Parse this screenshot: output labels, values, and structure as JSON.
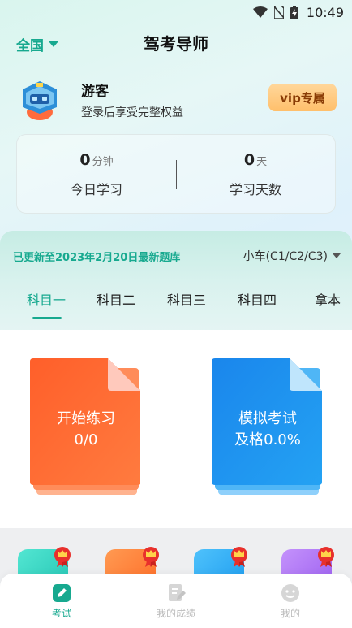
{
  "status_bar": {
    "time": "10:49"
  },
  "header": {
    "region": "全国",
    "title": "驾考导师"
  },
  "profile": {
    "name": "游客",
    "hint": "登录后享受完整权益",
    "vip_label": "vip专属"
  },
  "stats": {
    "today": {
      "value": "0",
      "unit": "分钟",
      "label": "今日学习"
    },
    "days": {
      "value": "0",
      "unit": "天",
      "label": "学习天数"
    }
  },
  "bank": {
    "update_text": "已更新至2023年2月20日最新题库",
    "car_type": "小车(C1/C2/C3)"
  },
  "tabs": [
    {
      "label": "科目一",
      "active": true
    },
    {
      "label": "科目二",
      "active": false
    },
    {
      "label": "科目三",
      "active": false
    },
    {
      "label": "科目四",
      "active": false
    },
    {
      "label": "拿本",
      "active": false
    }
  ],
  "cards": {
    "practice": {
      "title": "开始练习",
      "value": "0/0",
      "color": "#ff6a2e"
    },
    "exam": {
      "title": "模拟考试",
      "value": "及格0.0%",
      "color": "#1e90f0"
    }
  },
  "features": [
    {
      "icon": "feature-teal-icon",
      "color": "#2ad3c0"
    },
    {
      "icon": "feature-orange-icon",
      "color": "#ff7a30"
    },
    {
      "icon": "feature-blue-icon",
      "color": "#22a6f2"
    },
    {
      "icon": "feature-purple-icon",
      "color": "#a86cf0"
    }
  ],
  "bottom_nav": [
    {
      "label": "考试",
      "active": true,
      "icon": "pencil-icon"
    },
    {
      "label": "我的成绩",
      "active": false,
      "icon": "report-icon"
    },
    {
      "label": "我的",
      "active": false,
      "icon": "smile-icon"
    }
  ],
  "colors": {
    "accent": "#17a98f"
  }
}
